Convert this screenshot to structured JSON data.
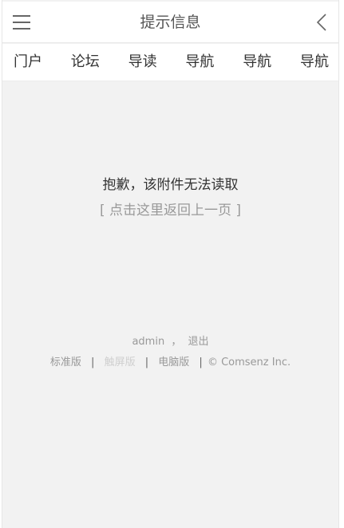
{
  "header": {
    "title": "提示信息"
  },
  "nav": {
    "items": [
      {
        "label": "门户"
      },
      {
        "label": "论坛"
      },
      {
        "label": "导读"
      },
      {
        "label": "导航"
      },
      {
        "label": "导航"
      },
      {
        "label": "导航"
      }
    ]
  },
  "message": {
    "text": "抱歉，该附件无法读取",
    "link": "[ 点击这里返回上一页 ]"
  },
  "footer": {
    "user": "admin",
    "comma": "，",
    "logout": "退出",
    "standard": "标准版",
    "touch": "触屏版",
    "pc": "电脑版",
    "copyright": "© Comsenz Inc.",
    "separator": "|"
  },
  "colors": {
    "background": "#f2f2f2",
    "header_bg": "#ffffff",
    "text_dark": "#333333",
    "text_muted": "#999999"
  }
}
